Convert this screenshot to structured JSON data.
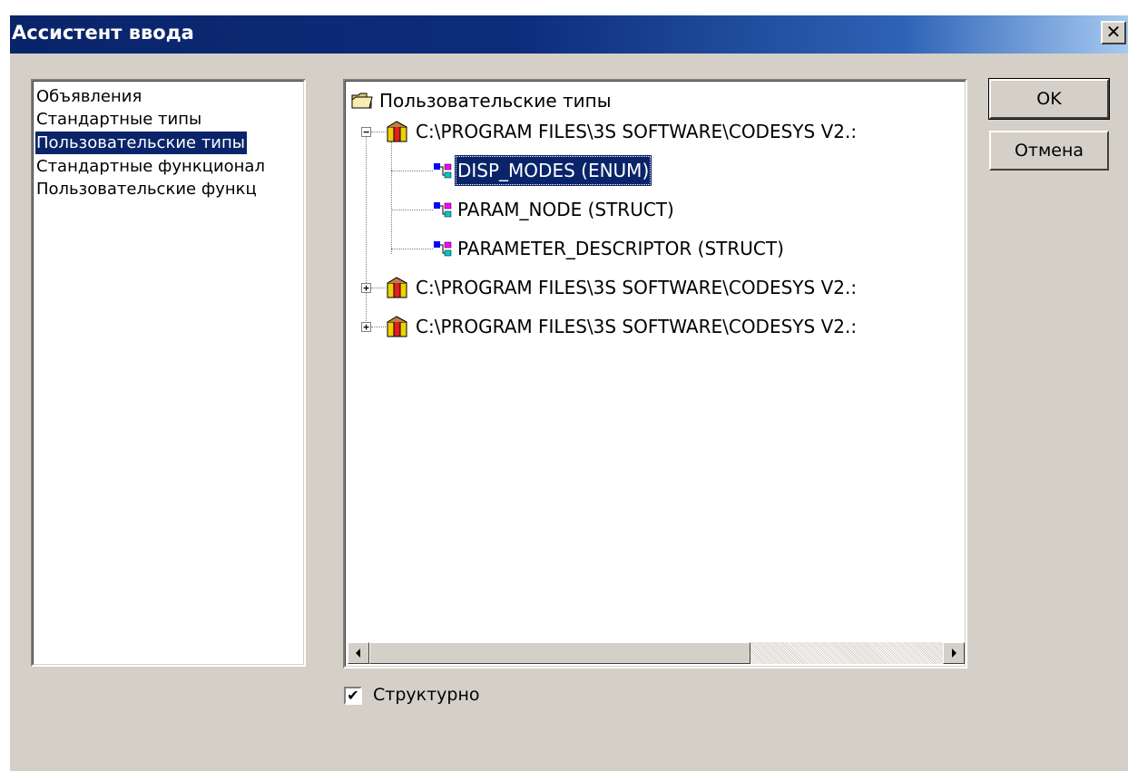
{
  "window": {
    "title": "Ассистент ввода",
    "close_glyph": "✕"
  },
  "categories": {
    "items": [
      {
        "label": "Объявления",
        "selected": false
      },
      {
        "label": "Стандартные типы",
        "selected": false
      },
      {
        "label": "Пользовательские типы",
        "selected": true
      },
      {
        "label": "Стандартные функционал",
        "selected": false
      },
      {
        "label": "Пользовательские функц",
        "selected": false
      }
    ]
  },
  "tree": {
    "root_label": "Пользовательские типы",
    "root_icon": "folder-icon",
    "nodes": [
      {
        "label": "C:\\PROGRAM FILES\\3S SOFTWARE\\CODESYS V2.:",
        "icon": "library-icon",
        "expanded": true,
        "children": [
          {
            "label": "DISP_MODES (ENUM)",
            "icon": "type-icon",
            "selected": true
          },
          {
            "label": "PARAM_NODE (STRUCT)",
            "icon": "type-icon",
            "selected": false
          },
          {
            "label": "PARAMETER_DESCRIPTOR (STRUCT)",
            "icon": "type-icon",
            "selected": false
          }
        ]
      },
      {
        "label": "C:\\PROGRAM FILES\\3S SOFTWARE\\CODESYS V2.:",
        "icon": "library-icon",
        "expanded": false
      },
      {
        "label": "C:\\PROGRAM FILES\\3S SOFTWARE\\CODESYS V2.:",
        "icon": "library-icon",
        "expanded": false
      }
    ]
  },
  "buttons": {
    "ok_label": "OK",
    "cancel_label": "Отмена"
  },
  "options": {
    "structured_label": "Структурно",
    "structured_checked": true,
    "check_glyph": "✔"
  },
  "colors": {
    "selection": "#0a246a",
    "title_start": "#0a246a",
    "title_end": "#a6caf0",
    "face": "#d4d0c8"
  }
}
